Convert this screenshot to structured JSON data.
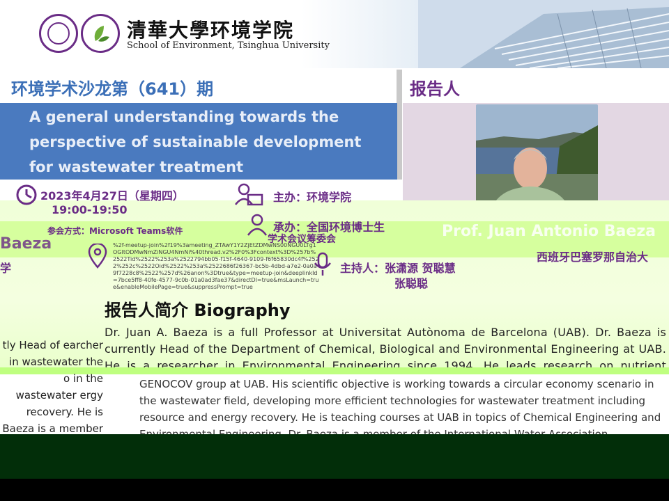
{
  "header": {
    "school_cn": "清華大學",
    "dept_cn": "环境学院",
    "school_en": "School of Environment, Tsinghua University"
  },
  "salon": {
    "title": "环境学术沙龙第（641）期"
  },
  "talk": {
    "title": "A general understanding towards the perspective of sustainable development for wastewater treatment"
  },
  "speaker": {
    "heading": "报告人",
    "name": "Prof. Juan Antonio Baeza",
    "affiliation": "西班牙巴塞罗那自治大"
  },
  "event": {
    "date": "2023年4月27日（星期四）",
    "time": "19:00-19:50",
    "mode": "参会方式：Microsoft Teams软件",
    "host": "主办：环境学院",
    "organizer": "承办：全国环境博士生",
    "organizer_line2": "学术会议筹委会",
    "moderator": "主持人：张潇源 贺聪慧",
    "moderator_2": "张聪聪",
    "link": "%2f-meetup-join%2f19%3ameeting_ZTAwY1Y2ZjEtZDMwNS00NGU0LTg1OGItODMwNmZiNGU4NmNi%40thread.v2%2F0%3Fcontext%3D%257b%2522Tid%2522%253a%2522794bb05-f15f-4640-9109-f6f65830dc4f%2522%252c%2522Oid%2522%253a%2522686f26367-bc5b-4dbd-a7e2-0a0a9f7228c8%2522%257d%26anon%3Dtrue&type=meetup-join&deeplinkId=7bce5ff8-40fe-4577-9c0b-01a0ad3fae37&directDl=true&msLaunch=true&enableMobilePage=true&suppressPrompt=true"
  },
  "fragments": {
    "baeza": "Baeza",
    "xue": "学",
    "left_text": "tly Head of earcher in wastewater the o in the wastewater ergy recovery. He is Baeza is a member"
  },
  "bio": {
    "heading": "报告人简介 Biography",
    "paragraph_1": "Dr. Juan A. Baeza is a full Professor at Universitat Autònoma de Barcelona (UAB). Dr. Baeza is currently Head of the Department of Chemical, Biological and Environmental Engineering at UAB. He is a researcher in Environmental Engineering since 1994. He leads research on nutrient removal from urban wastewater",
    "paragraph_2": "GENOCOV group at UAB. His scientific objective is working towards a circular economy scenario in the wastewater field, developing more efficient technologies for wastewater treatment including resource and energy recovery. He is teaching courses at UAB in topics of Chemical Engineering and Environmental Engineering. Dr. Baeza is a member of the International Water Association."
  },
  "colors": {
    "purple": "#6a2c86",
    "blue_title": "#3b6fb7",
    "blue_panel": "#4a7abf",
    "footer_green": "#022e09",
    "glitch_green": "#d6ff9e"
  }
}
